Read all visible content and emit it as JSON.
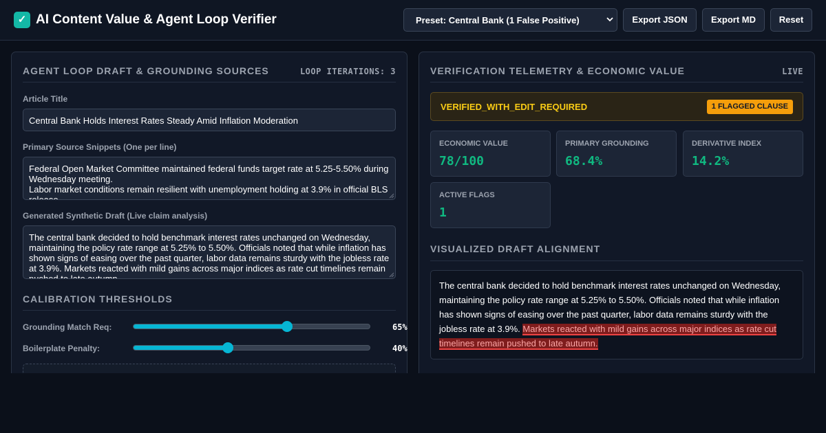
{
  "app": {
    "logo_glyph": "✓",
    "title": "AI Content Value & Agent Loop Verifier"
  },
  "toolbar": {
    "preset_label": "Preset: Central Bank (1 False Positive)",
    "export_json": "Export JSON",
    "export_md": "Export MD",
    "reset": "Reset"
  },
  "left": {
    "title": "AGENT LOOP DRAFT & GROUNDING SOURCES",
    "loop_tag": "LOOP ITERATIONS: 3",
    "article_title_label": "Article Title",
    "article_title_value": "Central Bank Holds Interest Rates Steady Amid Inflation Moderation",
    "sources_label": "Primary Source Snippets (One per line)",
    "sources_lines": [
      "Federal Open Market Committee maintained federal funds target rate at 5.25-5.50% during",
      "Wednesday meeting.",
      "Labor market conditions remain resilient with unemployment holding at 3.9% in official BLS",
      "release."
    ],
    "draft_label": "Generated Synthetic Draft (Live claim analysis)",
    "draft_lines": [
      "The central bank decided to hold benchmark interest rates unchanged on Wednesday,",
      "maintaining the policy rate range at 5.25% to 5.50%. Officials noted that while inflation has",
      "shown signs of easing over the past quarter, labor data remains sturdy with the jobless rate",
      "at 3.9%. Markets reacted with mild gains across major indices as rate cut timelines remain",
      "pushed to late autumn."
    ],
    "calibration_title": "CALIBRATION THRESHOLDS",
    "sliders": [
      {
        "label": "Grounding Match Req:",
        "value": 0.65,
        "display": "65%"
      },
      {
        "label": "Boilerplate Penalty:",
        "value": 0.4,
        "display": "40%"
      }
    ]
  },
  "right": {
    "title": "VERIFICATION TELEMETRY & ECONOMIC VALUE",
    "live_tag": "LIVE",
    "status": "VERIFIED_WITH_EDIT_REQUIRED",
    "flag_badge": "1 FLAGGED CLAUSE",
    "metrics": [
      {
        "label": "ECONOMIC VALUE",
        "value": "78/100"
      },
      {
        "label": "PRIMARY GROUNDING",
        "value": "68.4%"
      },
      {
        "label": "DERIVATIVE INDEX",
        "value": "14.2%"
      },
      {
        "label": "ACTIVE FLAGS",
        "value": "1"
      }
    ],
    "alignment_title": "VISUALIZED DRAFT ALIGNMENT",
    "alignment_verified": "The central bank decided to hold benchmark interest rates unchanged on Wednesday, maintaining the policy rate range at 5.25% to 5.50%. Officials noted that while inflation has shown signs of easing over the past quarter, labor data remains sturdy with the jobless rate at 3.9%.",
    "alignment_flagged": "Markets reacted with mild gains across major indices as rate cut timelines remain pushed to late autumn."
  },
  "colors": {
    "accent": "#06b6d4",
    "logo": "#14b8a6",
    "positive": "#10b981",
    "warning": "#facc15",
    "badge": "#f59e0b",
    "flag": "#ef4444"
  },
  "icons": {
    "logo": "check-icon",
    "preset_chevron": "chevron-down-icon",
    "resize": "resize-grip-icon"
  }
}
